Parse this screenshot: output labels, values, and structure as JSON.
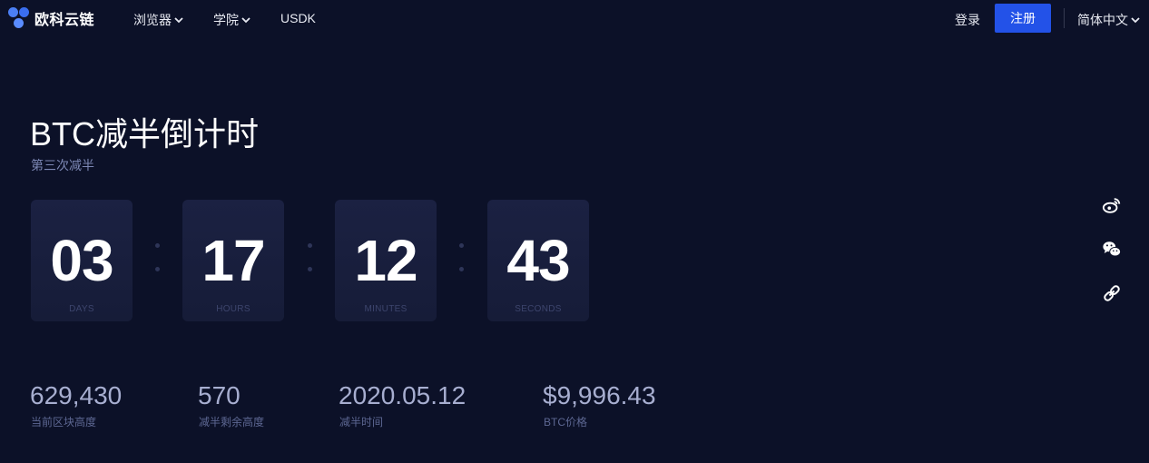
{
  "header": {
    "logo_text": "欧科云链",
    "nav": [
      {
        "label": "浏览器"
      },
      {
        "label": "学院"
      },
      {
        "label": "USDK"
      }
    ],
    "login_label": "登录",
    "register_label": "注册",
    "language_label": "简体中文",
    "accent_color": "#2352e8"
  },
  "hero": {
    "title": "BTC减半倒计时",
    "subtitle": "第三次减半"
  },
  "countdown": [
    {
      "value": "03",
      "unit": "DAYS"
    },
    {
      "value": "17",
      "unit": "HOURS"
    },
    {
      "value": "12",
      "unit": "MINUTES"
    },
    {
      "value": "43",
      "unit": "SECONDS"
    }
  ],
  "stats": [
    {
      "value": "629,430",
      "label": "当前区块高度"
    },
    {
      "value": "570",
      "label": "减半剩余高度"
    },
    {
      "value": "2020.05.12",
      "label": "减半时间"
    },
    {
      "value": "$9,996.43",
      "label": "BTC价格"
    }
  ],
  "share_icons": [
    "weibo-icon",
    "wechat-icon",
    "link-icon"
  ]
}
